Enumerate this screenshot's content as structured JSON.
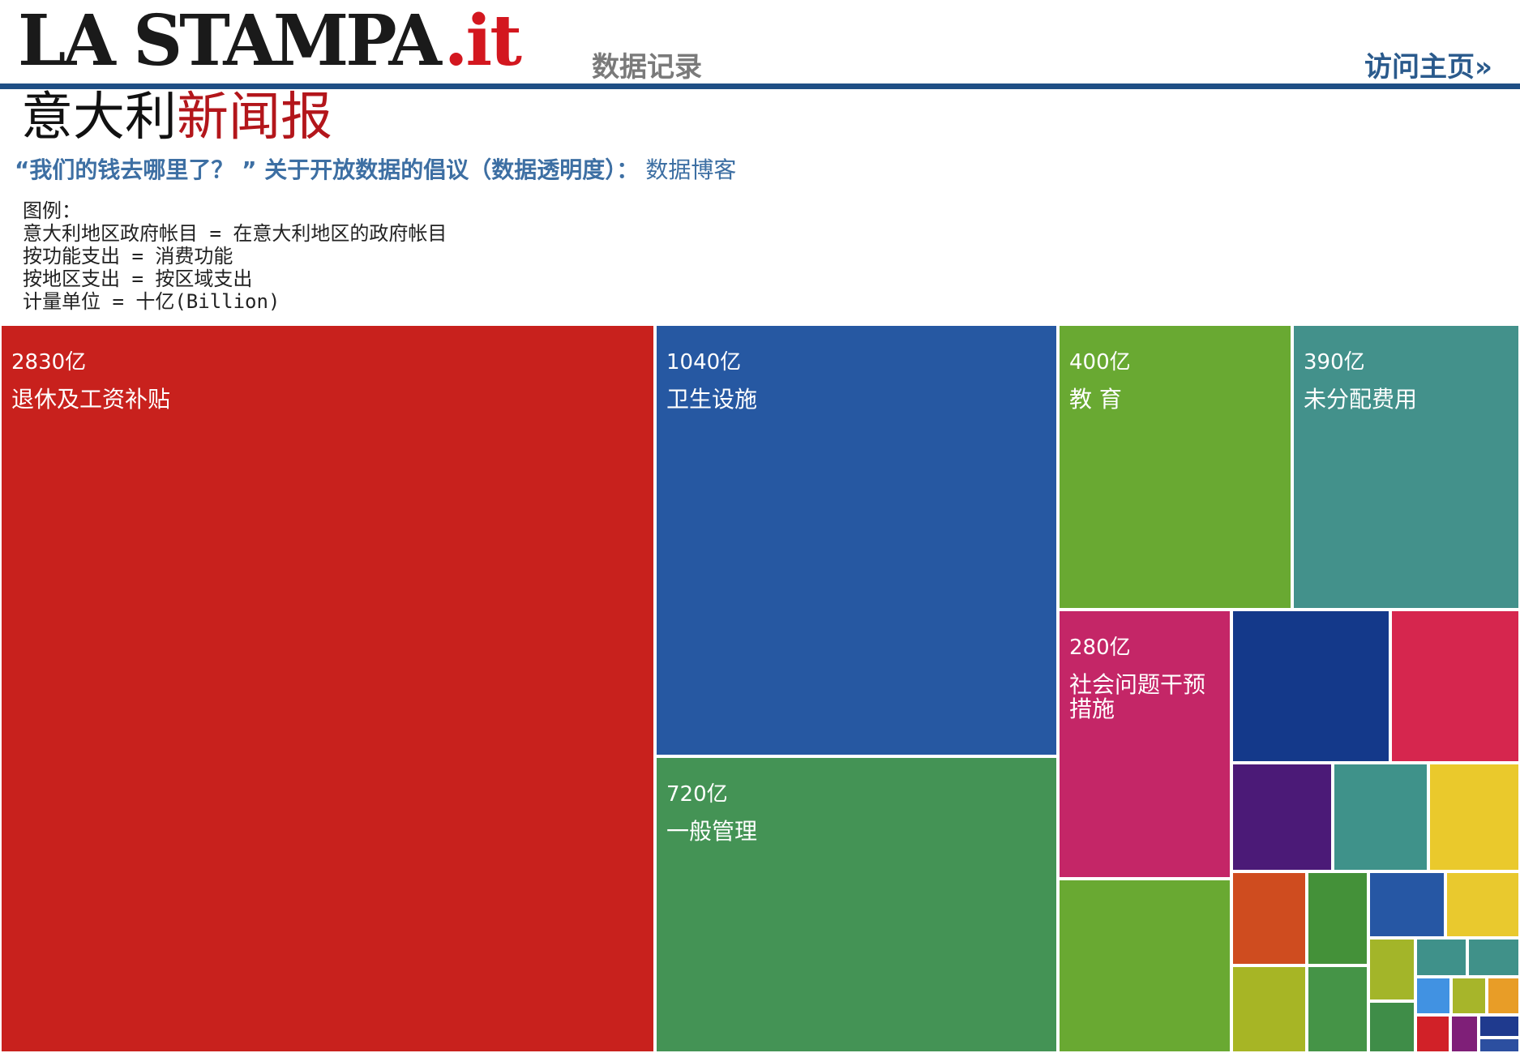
{
  "header": {
    "logo_main": "LA STAMPA",
    "logo_suffix": ".it",
    "section_label": "数据记录",
    "home_link": "访问主页»",
    "subtitle_part1": "意大利",
    "subtitle_part2": "新闻报",
    "tagline": "“我们的钱去哪里了？ ” 关于开放数据的倡议（数据透明度）：",
    "tagline_blog": "数据博客"
  },
  "legend": {
    "title": "图例：",
    "lines": [
      "意大利地区政府帐目 = 在意大利地区的政府帐目",
      "按功能支出 = 消费功能",
      "按地区支出 = 按区域支出",
      "计量单位 = 十亿(Billion)"
    ]
  },
  "chart_data": {
    "type": "treemap",
    "items": [
      {
        "value": "2830亿",
        "label": "退休及工资补贴",
        "color": "#c8211d"
      },
      {
        "value": "1040亿",
        "label": "卫生设施",
        "color": "#2658a2"
      },
      {
        "value": "720亿",
        "label": "一般管理",
        "color": "#449355"
      },
      {
        "value": "400亿",
        "label": "教 育",
        "color": "#69a932"
      },
      {
        "value": "390亿",
        "label": "未分配费用",
        "color": "#43918b"
      },
      {
        "value": "280亿",
        "label": "社会问题干预措施",
        "color": "#c42667"
      },
      {
        "value": "",
        "label": "",
        "color": "#14398a"
      },
      {
        "value": "",
        "label": "",
        "color": "#d6264e"
      },
      {
        "value": "",
        "label": "",
        "color": "#4b1a77"
      },
      {
        "value": "",
        "label": "",
        "color": "#3f928a"
      },
      {
        "value": "",
        "label": "",
        "color": "#eac92c"
      },
      {
        "value": "",
        "label": "",
        "color": "#69a932"
      },
      {
        "value": "",
        "label": "",
        "color": "#cf4c1f"
      },
      {
        "value": "",
        "label": "",
        "color": "#449139"
      },
      {
        "value": "",
        "label": "",
        "color": "#2657a4"
      },
      {
        "value": "",
        "label": "",
        "color": "#e9c92e"
      },
      {
        "value": "",
        "label": "",
        "color": "#a7b525"
      },
      {
        "value": "",
        "label": "",
        "color": "#459447"
      },
      {
        "value": "",
        "label": "",
        "color": "#a3b529"
      },
      {
        "value": "",
        "label": "",
        "color": "#3f918a"
      },
      {
        "value": "",
        "label": "",
        "color": "#409189"
      },
      {
        "value": "",
        "label": "",
        "color": "#4192e2"
      },
      {
        "value": "",
        "label": "",
        "color": "#a7b52a"
      },
      {
        "value": "",
        "label": "",
        "color": "#e89d27"
      },
      {
        "value": "",
        "label": "",
        "color": "#3f8d48"
      },
      {
        "value": "",
        "label": "",
        "color": "#d12128"
      },
      {
        "value": "",
        "label": "",
        "color": "#7f1f78"
      },
      {
        "value": "",
        "label": "",
        "color": "#1f3a8e"
      },
      {
        "value": "",
        "label": "",
        "color": "#2c4fa0"
      }
    ]
  }
}
